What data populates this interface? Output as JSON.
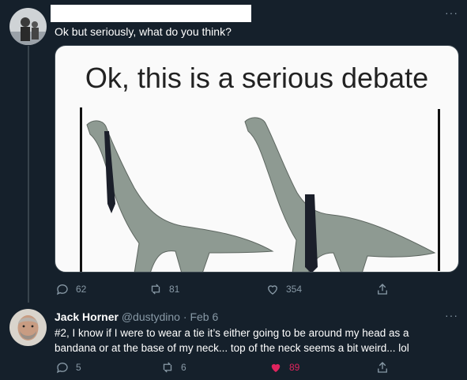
{
  "tweet1": {
    "text": "Ok but seriously, what do you think?",
    "more_label": "···",
    "image": {
      "caption": "Ok, this is a serious debate"
    },
    "actions": {
      "replies": "62",
      "retweets": "81",
      "likes": "354"
    }
  },
  "tweet2": {
    "display_name": "Jack Horner",
    "handle": "@dustydino",
    "separator": "·",
    "date": "Feb 6",
    "more_label": "···",
    "text_line1": "#2, I know if I were to wear a tie it’s either going to be around my head as a",
    "text_line2": "bandana or at the base of my neck... top of the neck seems a bit weird... lol",
    "actions": {
      "replies": "5",
      "retweets": "6",
      "likes": "89"
    }
  },
  "colors": {
    "background": "#15202b",
    "muted": "#8899a6",
    "like_active": "#e0245e",
    "divider": "#38444d"
  }
}
